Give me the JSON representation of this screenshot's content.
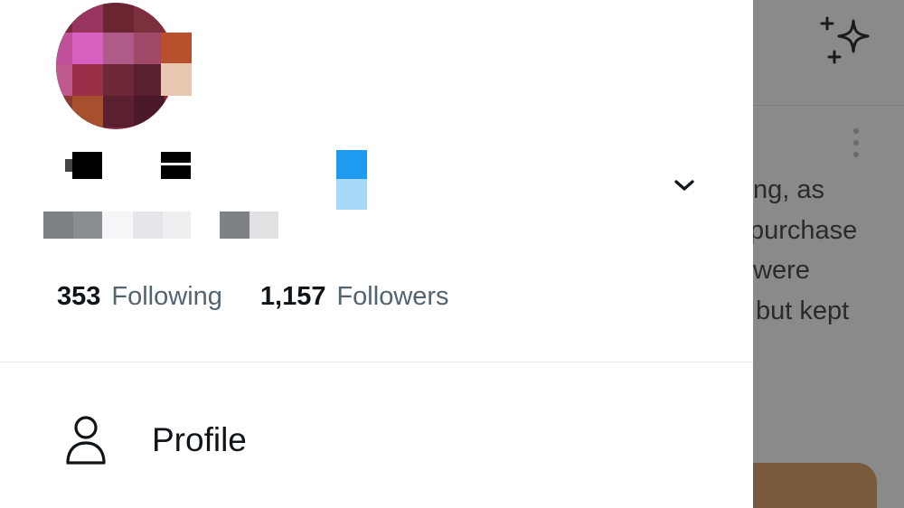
{
  "profile": {
    "following_count": "353",
    "following_label": "Following",
    "followers_count": "1,157",
    "followers_label": "Followers"
  },
  "menu": {
    "items": [
      {
        "label": "Profile",
        "icon": "person-icon"
      }
    ]
  },
  "header": {
    "switch_account_icon": "chevron-down-icon"
  },
  "background_feed": {
    "top_icon": "sparkle-icon",
    "more_icon": "more-vertical-icon",
    "tweet_text_lines": [
      "ng, as",
      "purchase",
      "were",
      "but kept"
    ]
  },
  "colors": {
    "accent": "#1d9bf0",
    "text_primary": "#0f1419",
    "text_secondary": "#536471",
    "divider": "#e6e9ec",
    "backdrop": "#8a8a8a"
  }
}
